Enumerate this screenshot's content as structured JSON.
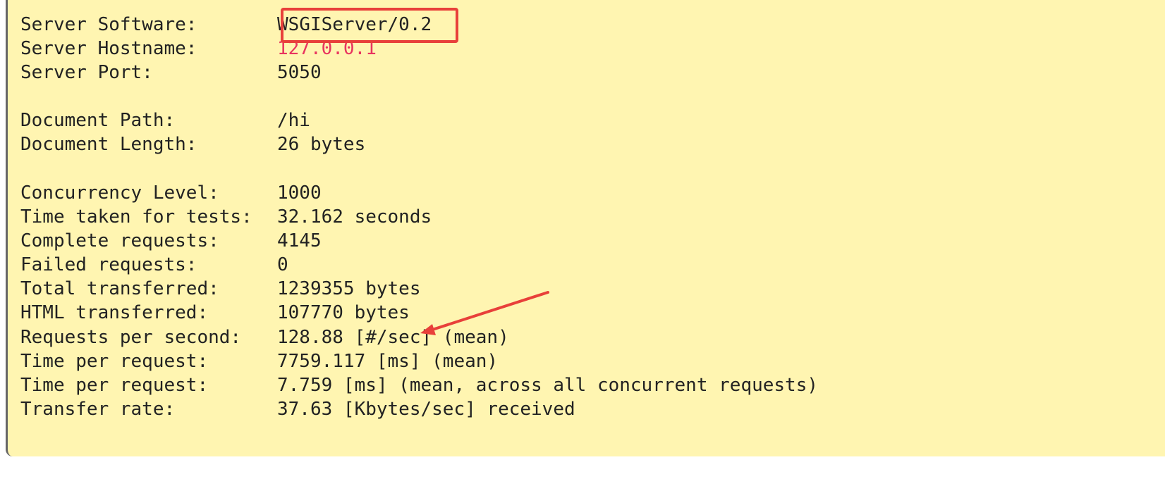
{
  "report": {
    "rows": [
      {
        "label": "Server Software:",
        "value": "WSGIServer/0.2"
      },
      {
        "label": "Server Hostname:",
        "value": "127.0.0.1"
      },
      {
        "label": "Server Port:",
        "value": "5050"
      },
      {
        "label": "Document Path:",
        "value": "/hi"
      },
      {
        "label": "Document Length:",
        "value": "26 bytes"
      },
      {
        "label": "Concurrency Level:",
        "value": "1000"
      },
      {
        "label": "Time taken for tests:",
        "value": "32.162 seconds"
      },
      {
        "label": "Complete requests:",
        "value": "4145"
      },
      {
        "label": "Failed requests:",
        "value": "0"
      },
      {
        "label": "Total transferred:",
        "value": "1239355 bytes"
      },
      {
        "label": "HTML transferred:",
        "value": "107770 bytes"
      },
      {
        "label": "Requests per second:",
        "value": "128.88 [#/sec] (mean)"
      },
      {
        "label": "Time per request:",
        "value": "7759.117 [ms] (mean)"
      },
      {
        "label": "Time per request:",
        "value": "7.759 [ms] (mean, across all concurrent requests)"
      },
      {
        "label": "Transfer rate:",
        "value": "37.63 [Kbytes/sec] received"
      }
    ]
  },
  "colors": {
    "background": "#fff5b1",
    "text": "#222222",
    "hostname": "#e8345f",
    "annotation": "#e8403a"
  }
}
